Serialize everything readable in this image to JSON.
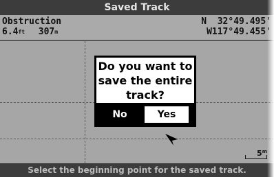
{
  "title": "Saved Track",
  "info": {
    "label": "Obstruction",
    "distance": "6.4",
    "distance_unit": "ft",
    "bearing": "307",
    "bearing_unit": "m",
    "latitude": "N  32°49.495'",
    "longitude": "W117°49.455'"
  },
  "dialog": {
    "line1": "Do you want to",
    "line2": "save the entire",
    "line3": "track?",
    "no_label": "No",
    "yes_label": "Yes"
  },
  "map": {
    "scale_label": "5"
  },
  "status": "Select the beginning point for the saved track.",
  "colors": {
    "bar_bg": "#3c3c3c",
    "map_bg": "#a6a6a6",
    "dialog_border": "#000000"
  }
}
